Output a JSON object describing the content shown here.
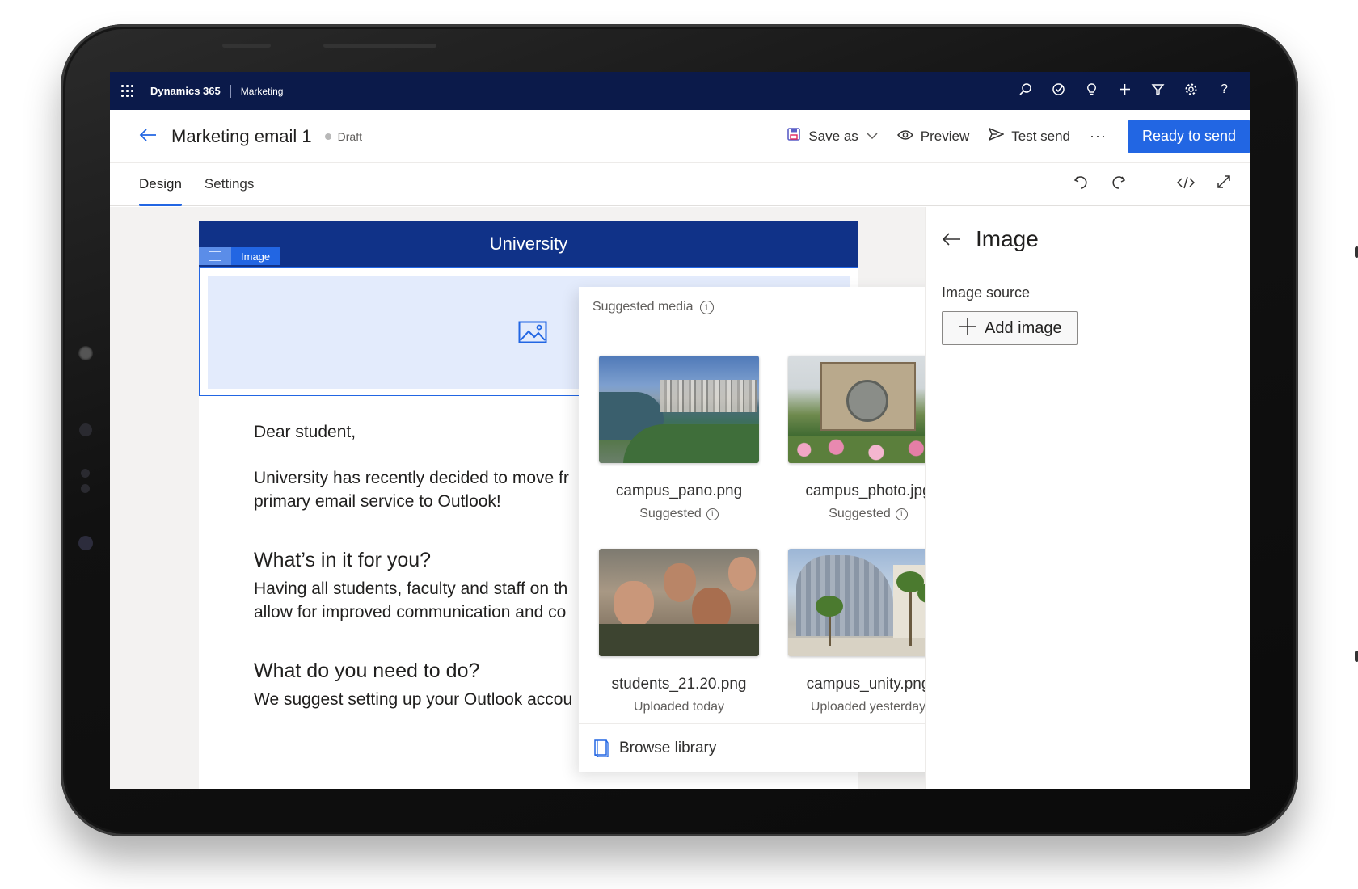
{
  "topnav": {
    "brand": "Dynamics 365",
    "module": "Marketing",
    "icons": [
      "search-icon",
      "task-icon",
      "lightbulb-icon",
      "plus-icon",
      "filter-icon",
      "gear-icon",
      "help-icon"
    ],
    "help_glyph": "?"
  },
  "header": {
    "title": "Marketing email 1",
    "status": "Draft",
    "save_as": "Save as",
    "preview": "Preview",
    "test_send": "Test send",
    "more": "···",
    "ready": "Ready to send",
    "accent": "#2266e3"
  },
  "tabs": [
    {
      "label": "Design",
      "active": true
    },
    {
      "label": "Settings",
      "active": false
    }
  ],
  "email": {
    "banner": "University",
    "banner_color": "#103288",
    "selected_block_label": "Image",
    "greeting": "Dear student,",
    "para1_line1": "University has recently decided to move fr",
    "para1_line2": "primary email service to Outlook!",
    "heading1": "What’s in it for you?",
    "para2_line1": "Having all students, faculty and staff on th",
    "para2_line2": "allow for improved communication and co",
    "heading2": "What do you need to do?",
    "para3_line1": "We suggest setting up your Outlook accou"
  },
  "suggested_media": {
    "title": "Suggested media",
    "items": [
      {
        "name": "campus_pano.png",
        "sub": "Suggested",
        "info": true
      },
      {
        "name": "campus_photo.jpg",
        "sub": "Suggested",
        "info": true
      },
      {
        "name": "students_21.20.png",
        "sub": "Uploaded today",
        "info": false
      },
      {
        "name": "campus_unity.png",
        "sub": "Uploaded yesterday",
        "info": false
      }
    ],
    "browse": "Browse library"
  },
  "properties": {
    "title": "Image",
    "source_label": "Image source",
    "add_button": "Add image"
  }
}
